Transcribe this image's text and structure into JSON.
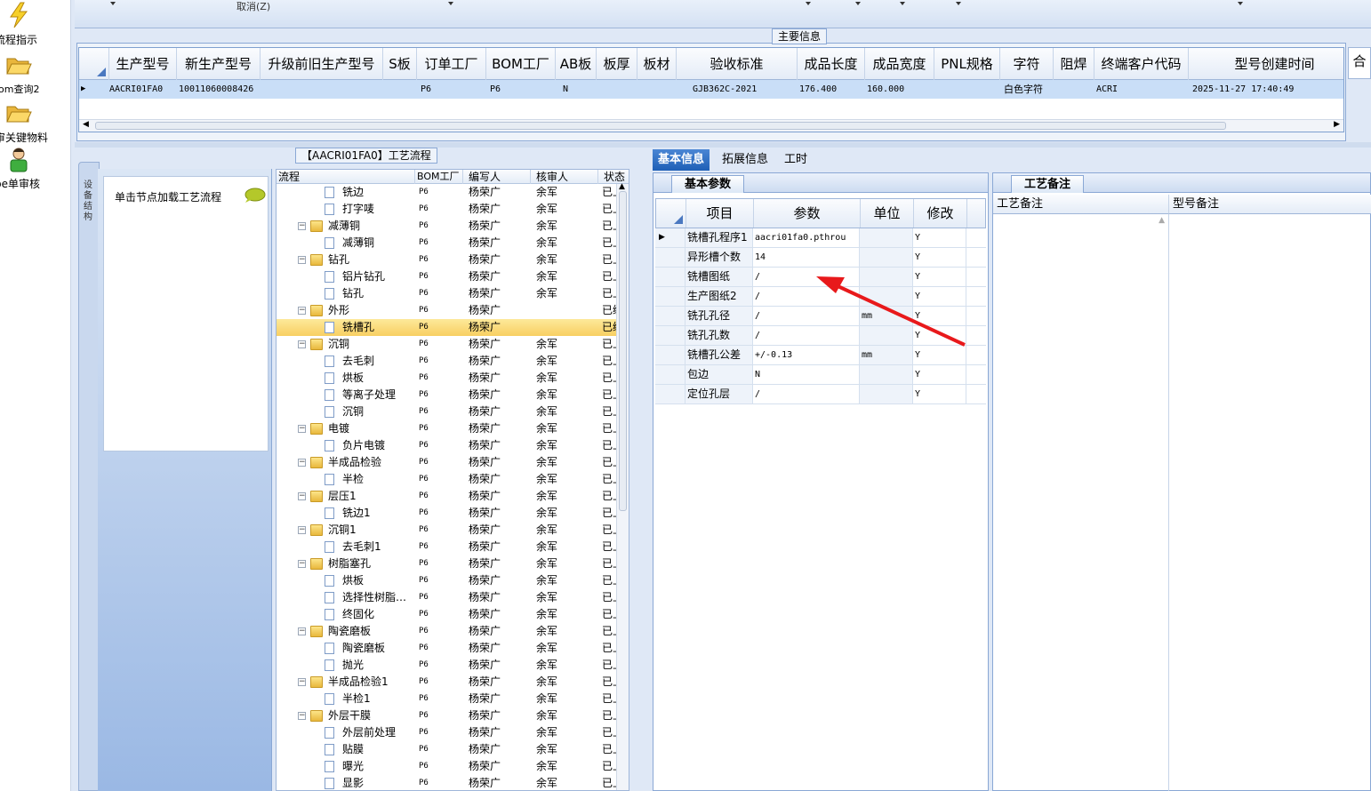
{
  "launcher": {
    "items": [
      {
        "label": "流程指示",
        "icon": "lightning-icon"
      },
      {
        "label": "om查询2",
        "icon": "folder-open-icon"
      },
      {
        "label": "审关键物料",
        "icon": "folder-open-icon"
      },
      {
        "label": "pe单审核",
        "icon": "user-icon"
      }
    ]
  },
  "topbar": {
    "cancel_label": "取消(Z)"
  },
  "main_info": {
    "title": "主要信息",
    "columns": [
      "生产型号",
      "新生产型号",
      "升级前旧生产型号",
      "S板",
      "订单工厂",
      "BOM工厂",
      "AB板",
      "板厚",
      "板材",
      "验收标准",
      "成品长度",
      "成品宽度",
      "PNL规格",
      "字符",
      "阻焊",
      "终端客户代码",
      "型号创建时间"
    ],
    "row": [
      "AACRI01FA0",
      "10011060008426",
      "",
      "",
      "P6",
      "P6",
      "N",
      "",
      "",
      "GJB362C-2021",
      "176.400",
      "160.000",
      "",
      "白色字符",
      "",
      "ACRI",
      "2025-11-27 17:40:49"
    ],
    "side_button": "合"
  },
  "process": {
    "title": "【AACRI01FA0】工艺流程",
    "side_tab": "设备结构",
    "hint": "单击节点加载工艺流程",
    "columns": [
      "流程",
      "BOM工厂",
      "编写人",
      "核审人",
      "状态"
    ],
    "rows": [
      {
        "name": "铣边",
        "level": 2,
        "type": "doc",
        "bom": "P6",
        "writer": "杨荣广",
        "checker": "余军",
        "status": "已上区"
      },
      {
        "name": "打字唛",
        "level": 2,
        "type": "doc",
        "bom": "P6",
        "writer": "杨荣广",
        "checker": "余军",
        "status": "已上区"
      },
      {
        "name": "减薄铜",
        "level": 1,
        "type": "folder",
        "bom": "P6",
        "writer": "杨荣广",
        "checker": "余军",
        "status": "已上区"
      },
      {
        "name": "减薄铜",
        "level": 2,
        "type": "doc",
        "bom": "P6",
        "writer": "杨荣广",
        "checker": "余军",
        "status": "已上区"
      },
      {
        "name": "钻孔",
        "level": 1,
        "type": "folder",
        "bom": "P6",
        "writer": "杨荣广",
        "checker": "余军",
        "status": "已上区"
      },
      {
        "name": "铝片钻孔",
        "level": 2,
        "type": "doc",
        "bom": "P6",
        "writer": "杨荣广",
        "checker": "余军",
        "status": "已上区"
      },
      {
        "name": "钻孔",
        "level": 2,
        "type": "doc",
        "bom": "P6",
        "writer": "杨荣广",
        "checker": "余军",
        "status": "已上区"
      },
      {
        "name": "外形",
        "level": 1,
        "type": "folder",
        "bom": "P6",
        "writer": "杨荣广",
        "checker": "",
        "status": "已编写"
      },
      {
        "name": "铣槽孔",
        "level": 2,
        "type": "doc",
        "bom": "P6",
        "writer": "杨荣广",
        "checker": "",
        "status": "已编写",
        "selected": true
      },
      {
        "name": "沉铜",
        "level": 1,
        "type": "folder",
        "bom": "P6",
        "writer": "杨荣广",
        "checker": "余军",
        "status": "已上区"
      },
      {
        "name": "去毛刺",
        "level": 2,
        "type": "doc",
        "bom": "P6",
        "writer": "杨荣广",
        "checker": "余军",
        "status": "已上区"
      },
      {
        "name": "烘板",
        "level": 2,
        "type": "doc",
        "bom": "P6",
        "writer": "杨荣广",
        "checker": "余军",
        "status": "已上区"
      },
      {
        "name": "等离子处理",
        "level": 2,
        "type": "doc",
        "bom": "P6",
        "writer": "杨荣广",
        "checker": "余军",
        "status": "已上区"
      },
      {
        "name": "沉铜",
        "level": 2,
        "type": "doc",
        "bom": "P6",
        "writer": "杨荣广",
        "checker": "余军",
        "status": "已上区"
      },
      {
        "name": "电镀",
        "level": 1,
        "type": "folder",
        "bom": "P6",
        "writer": "杨荣广",
        "checker": "余军",
        "status": "已上区"
      },
      {
        "name": "负片电镀",
        "level": 2,
        "type": "doc",
        "bom": "P6",
        "writer": "杨荣广",
        "checker": "余军",
        "status": "已上区"
      },
      {
        "name": "半成品检验",
        "level": 1,
        "type": "folder",
        "bom": "P6",
        "writer": "杨荣广",
        "checker": "余军",
        "status": "已上区"
      },
      {
        "name": "半检",
        "level": 2,
        "type": "doc",
        "bom": "P6",
        "writer": "杨荣广",
        "checker": "余军",
        "status": "已上区"
      },
      {
        "name": "层压1",
        "level": 1,
        "type": "folder",
        "bom": "P6",
        "writer": "杨荣广",
        "checker": "余军",
        "status": "已上区"
      },
      {
        "name": "铣边1",
        "level": 2,
        "type": "doc",
        "bom": "P6",
        "writer": "杨荣广",
        "checker": "余军",
        "status": "已上区"
      },
      {
        "name": "沉铜1",
        "level": 1,
        "type": "folder",
        "bom": "P6",
        "writer": "杨荣广",
        "checker": "余军",
        "status": "已上区"
      },
      {
        "name": "去毛刺1",
        "level": 2,
        "type": "doc",
        "bom": "P6",
        "writer": "杨荣广",
        "checker": "余军",
        "status": "已上区"
      },
      {
        "name": "树脂塞孔",
        "level": 1,
        "type": "folder",
        "bom": "P6",
        "writer": "杨荣广",
        "checker": "余军",
        "status": "已上区"
      },
      {
        "name": "烘板",
        "level": 2,
        "type": "doc",
        "bom": "P6",
        "writer": "杨荣广",
        "checker": "余军",
        "status": "已上区"
      },
      {
        "name": "选择性树脂…",
        "level": 2,
        "type": "doc",
        "bom": "P6",
        "writer": "杨荣广",
        "checker": "余军",
        "status": "已上区"
      },
      {
        "name": "终固化",
        "level": 2,
        "type": "doc",
        "bom": "P6",
        "writer": "杨荣广",
        "checker": "余军",
        "status": "已上区"
      },
      {
        "name": "陶瓷磨板",
        "level": 1,
        "type": "folder",
        "bom": "P6",
        "writer": "杨荣广",
        "checker": "余军",
        "status": "已上区"
      },
      {
        "name": "陶瓷磨板",
        "level": 2,
        "type": "doc",
        "bom": "P6",
        "writer": "杨荣广",
        "checker": "余军",
        "status": "已上区"
      },
      {
        "name": "抛光",
        "level": 2,
        "type": "doc",
        "bom": "P6",
        "writer": "杨荣广",
        "checker": "余军",
        "status": "已上区"
      },
      {
        "name": "半成品检验1",
        "level": 1,
        "type": "folder",
        "bom": "P6",
        "writer": "杨荣广",
        "checker": "余军",
        "status": "已上区"
      },
      {
        "name": "半检1",
        "level": 2,
        "type": "doc",
        "bom": "P6",
        "writer": "杨荣广",
        "checker": "余军",
        "status": "已上区"
      },
      {
        "name": "外层干膜",
        "level": 1,
        "type": "folder",
        "bom": "P6",
        "writer": "杨荣广",
        "checker": "余军",
        "status": "已上区"
      },
      {
        "name": "外层前处理",
        "level": 2,
        "type": "doc",
        "bom": "P6",
        "writer": "杨荣广",
        "checker": "余军",
        "status": "已上区"
      },
      {
        "name": "贴膜",
        "level": 2,
        "type": "doc",
        "bom": "P6",
        "writer": "杨荣广",
        "checker": "余军",
        "status": "已上区"
      },
      {
        "name": "曝光",
        "level": 2,
        "type": "doc",
        "bom": "P6",
        "writer": "杨荣广",
        "checker": "余军",
        "status": "已上区"
      },
      {
        "name": "显影",
        "level": 2,
        "type": "doc",
        "bom": "P6",
        "writer": "杨荣广",
        "checker": "余军",
        "status": "已上区"
      }
    ]
  },
  "tabs": [
    {
      "label": "基本信息",
      "active": true
    },
    {
      "label": "拓展信息",
      "active": false
    },
    {
      "label": "工时",
      "active": false
    }
  ],
  "basic_params": {
    "title": "基本参数",
    "columns": [
      "项目",
      "参数",
      "单位",
      "修改"
    ],
    "rows": [
      {
        "item": "铣槽孔程序1",
        "param": "aacri01fa0.pthrou",
        "unit": "",
        "mod": "Y"
      },
      {
        "item": "异形槽个数",
        "param": "14",
        "unit": "",
        "mod": "Y"
      },
      {
        "item": "铣槽图纸",
        "param": "/",
        "unit": "",
        "mod": "Y"
      },
      {
        "item": "生产图纸2",
        "param": "/",
        "unit": "",
        "mod": "Y"
      },
      {
        "item": "铣孔孔径",
        "param": "/",
        "unit": "mm",
        "mod": "Y"
      },
      {
        "item": "铣孔孔数",
        "param": "/",
        "unit": "",
        "mod": "Y"
      },
      {
        "item": "铣槽孔公差",
        "param": "+/-0.13",
        "unit": "mm",
        "mod": "Y"
      },
      {
        "item": "包边",
        "param": "N",
        "unit": "",
        "mod": "Y"
      },
      {
        "item": "定位孔层",
        "param": "/",
        "unit": "",
        "mod": "Y"
      }
    ]
  },
  "notes": {
    "title": "工艺备注",
    "columns": [
      "工艺备注",
      "型号备注"
    ]
  },
  "colors": {
    "accent": "#1e5fb6",
    "selected_row": "#f8cf62",
    "arrow": "#e8191b"
  }
}
